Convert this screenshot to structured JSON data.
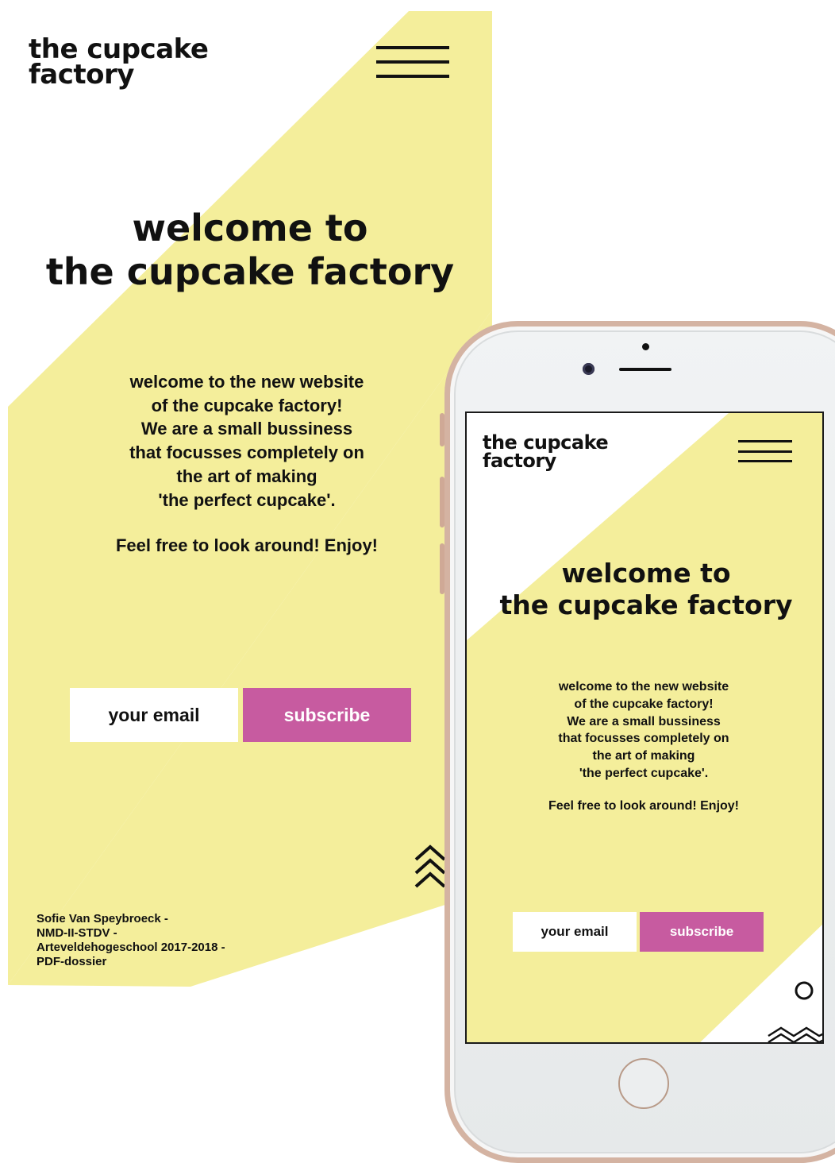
{
  "brand": {
    "line1": "the cupcake",
    "line2": "factory"
  },
  "hero": {
    "title_line1": "welcome to",
    "title_line2": "the cupcake factory"
  },
  "intro": {
    "lines": [
      "welcome to the new website",
      "of the cupcake factory!",
      "We are a small bussiness",
      "that focusses completely on",
      "the art of making",
      "'the perfect cupcake'."
    ],
    "cta": "Feel free to look around! Enjoy!"
  },
  "newsletter": {
    "email_placeholder": "your email",
    "subscribe_label": "subscribe"
  },
  "credits": {
    "lines": [
      "Sofie Van Speybroeck -",
      "NMD-II-STDV -",
      "Arteveldehogeschool 2017-2018 -",
      "PDF-dossier"
    ]
  },
  "icons": {
    "menu": "hamburger-menu-icon",
    "scroll": "chevrons-up-icon",
    "circle": "circle-icon",
    "zigzag": "zigzag-icon"
  },
  "colors": {
    "yellow": "#F4EE9B",
    "subscribe": "#C75BA0",
    "text": "#111111",
    "phone_frame": "#D4B3A2"
  }
}
